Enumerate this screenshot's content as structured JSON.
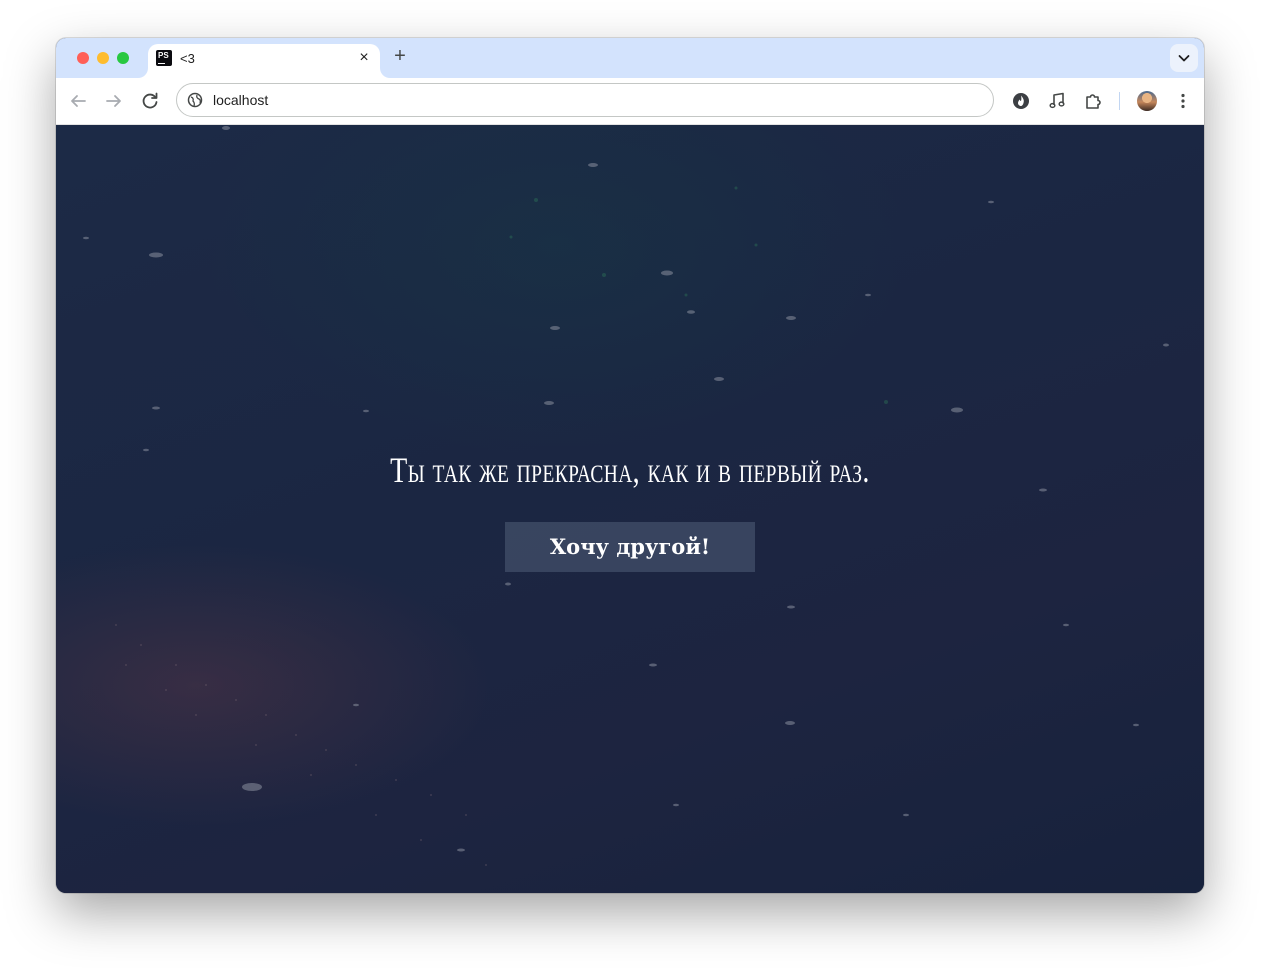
{
  "browser": {
    "tab": {
      "favicon_text": "PS",
      "title": "<3",
      "close_label": "×"
    },
    "new_tab_label": "+",
    "address_bar": {
      "url": "localhost"
    }
  },
  "page": {
    "quote": "Ты так же прекрасна, как и в первый раз.",
    "button_label": "Хочу другой!"
  }
}
